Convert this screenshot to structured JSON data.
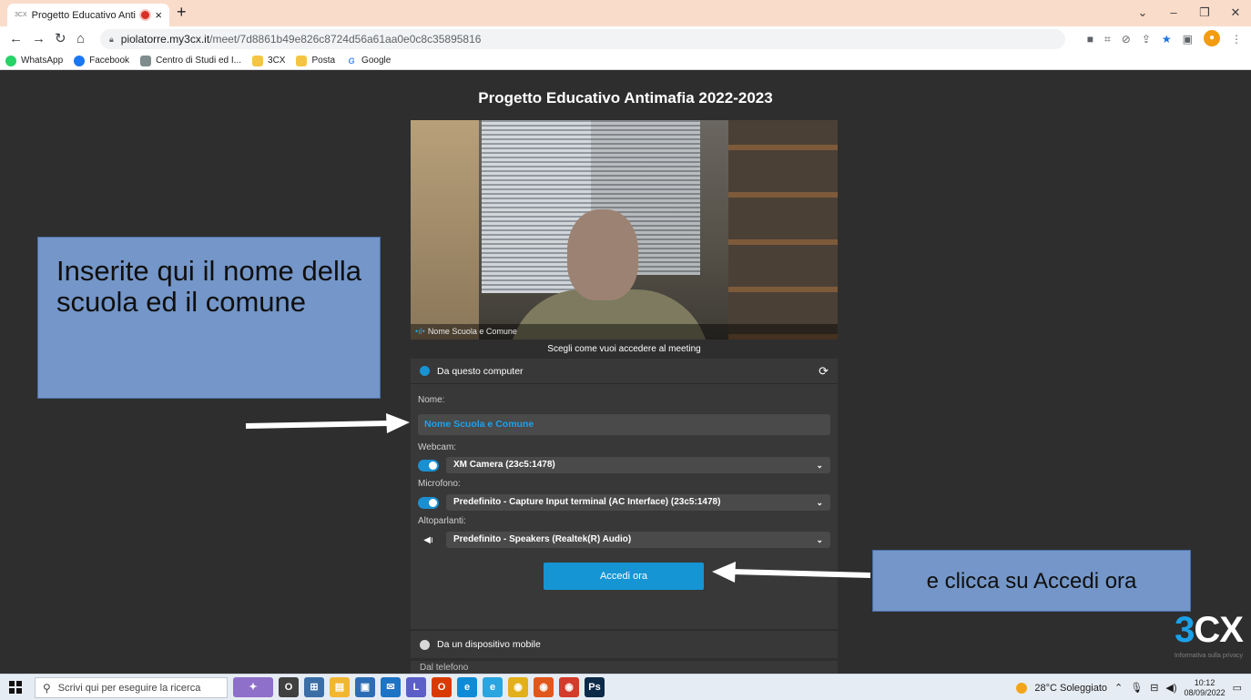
{
  "browser": {
    "tab_favicon": "3CX",
    "tab_title": "Progetto Educativo Antimafi",
    "tab_close": "×",
    "new_tab": "+",
    "window_controls": [
      "⌄",
      "–",
      "❐",
      "✕"
    ],
    "url_host": "piolatorre.my3cx.it",
    "url_path": "/meet/7d8861b49e826c8724d56a61aa0e0c8c35895816",
    "bookmarks": [
      {
        "label": "WhatsApp",
        "icon": "whatsapp-icon",
        "color": "#25d366"
      },
      {
        "label": "Facebook",
        "icon": "facebook-icon",
        "color": "#1877f2"
      },
      {
        "label": "Centro di Studi ed I...",
        "icon": "page-icon",
        "color": "#7f8c8d"
      },
      {
        "label": "3CX",
        "icon": "folder-icon",
        "color": "#f4c542"
      },
      {
        "label": "Posta",
        "icon": "folder-icon",
        "color": "#f4c542"
      },
      {
        "label": "Google",
        "icon": "google-icon",
        "color": "#4285f4"
      }
    ]
  },
  "meeting": {
    "title": "Progetto Educativo Antimafia 2022-2023",
    "video_caption": "Nome Scuola e Comune",
    "choose_label": "Scegli come vuoi accedere al meeting",
    "option_computer": "Da questo computer",
    "name_label": "Nome:",
    "name_value": "Nome Scuola e Comune",
    "webcam_label": "Webcam:",
    "webcam_value": "XM Camera (23c5:1478)",
    "mic_label": "Microfono:",
    "mic_value": "Predefinito - Capture Input terminal (AC Interface) (23c5:1478)",
    "speakers_label": "Altoparlanti:",
    "speakers_value": "Predefinito - Speakers (Realtek(R) Audio)",
    "join_button": "Accedi ora",
    "option_mobile": "Da un dispositivo mobile",
    "option_phone": "Dal telefono",
    "brand_3": "3",
    "brand_cx": "CX",
    "privacy": "Informativa sulla privacy"
  },
  "annotations": {
    "note_name": "Inserite qui il nome della scuola ed il comune",
    "note_join": "e clicca su Accedi ora"
  },
  "taskbar": {
    "search_placeholder": "Scrivi qui per eseguire la ricerca",
    "weather": "28°C Soleggiato",
    "time": "10:12",
    "date": "08/09/2022",
    "apps": [
      {
        "icon": "task-view-icon",
        "color": "#404040",
        "glyph": "O"
      },
      {
        "icon": "widgets-icon",
        "color": "#3b6ea5",
        "glyph": "⊞"
      },
      {
        "icon": "file-explorer-icon",
        "color": "#f2b632",
        "glyph": "▤"
      },
      {
        "icon": "store-icon",
        "color": "#2d6db5",
        "glyph": "▣"
      },
      {
        "icon": "mail-icon",
        "color": "#1d73c4",
        "glyph": "✉"
      },
      {
        "icon": "teams-icon",
        "color": "#5b5fc7",
        "glyph": "L"
      },
      {
        "icon": "office-icon",
        "color": "#d83b01",
        "glyph": "O"
      },
      {
        "icon": "edge-icon",
        "color": "#0f8bd6",
        "glyph": "e"
      },
      {
        "icon": "ie-icon",
        "color": "#2ba5e0",
        "glyph": "e"
      },
      {
        "icon": "chrome-icon",
        "color": "#e2b01a",
        "glyph": "◉"
      },
      {
        "icon": "firefox-icon",
        "color": "#e0581b",
        "glyph": "◉"
      },
      {
        "icon": "chrome-profile-icon",
        "color": "#d33b2b",
        "glyph": "◉"
      },
      {
        "icon": "photoshop-icon",
        "color": "#0d2a48",
        "glyph": "Ps"
      }
    ]
  }
}
